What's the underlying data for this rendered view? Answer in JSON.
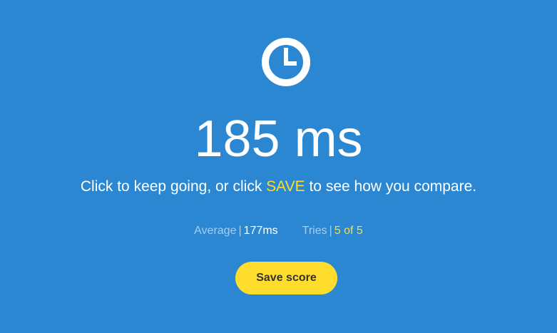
{
  "result": {
    "value": "185 ms",
    "icon": "clock-icon"
  },
  "message": {
    "before": "Click to keep going, or click ",
    "highlight": "SAVE",
    "after": " to see how you compare."
  },
  "stats": {
    "average": {
      "label": "Average",
      "separator": "|",
      "value": "177ms"
    },
    "tries": {
      "label": "Tries",
      "separator": "|",
      "value": "5 of 5"
    }
  },
  "save_button": {
    "label": "Save score"
  },
  "colors": {
    "background": "#2b87d1",
    "accent": "#ffdd2d",
    "text": "#ffffff",
    "muted": "#a9cdec"
  }
}
